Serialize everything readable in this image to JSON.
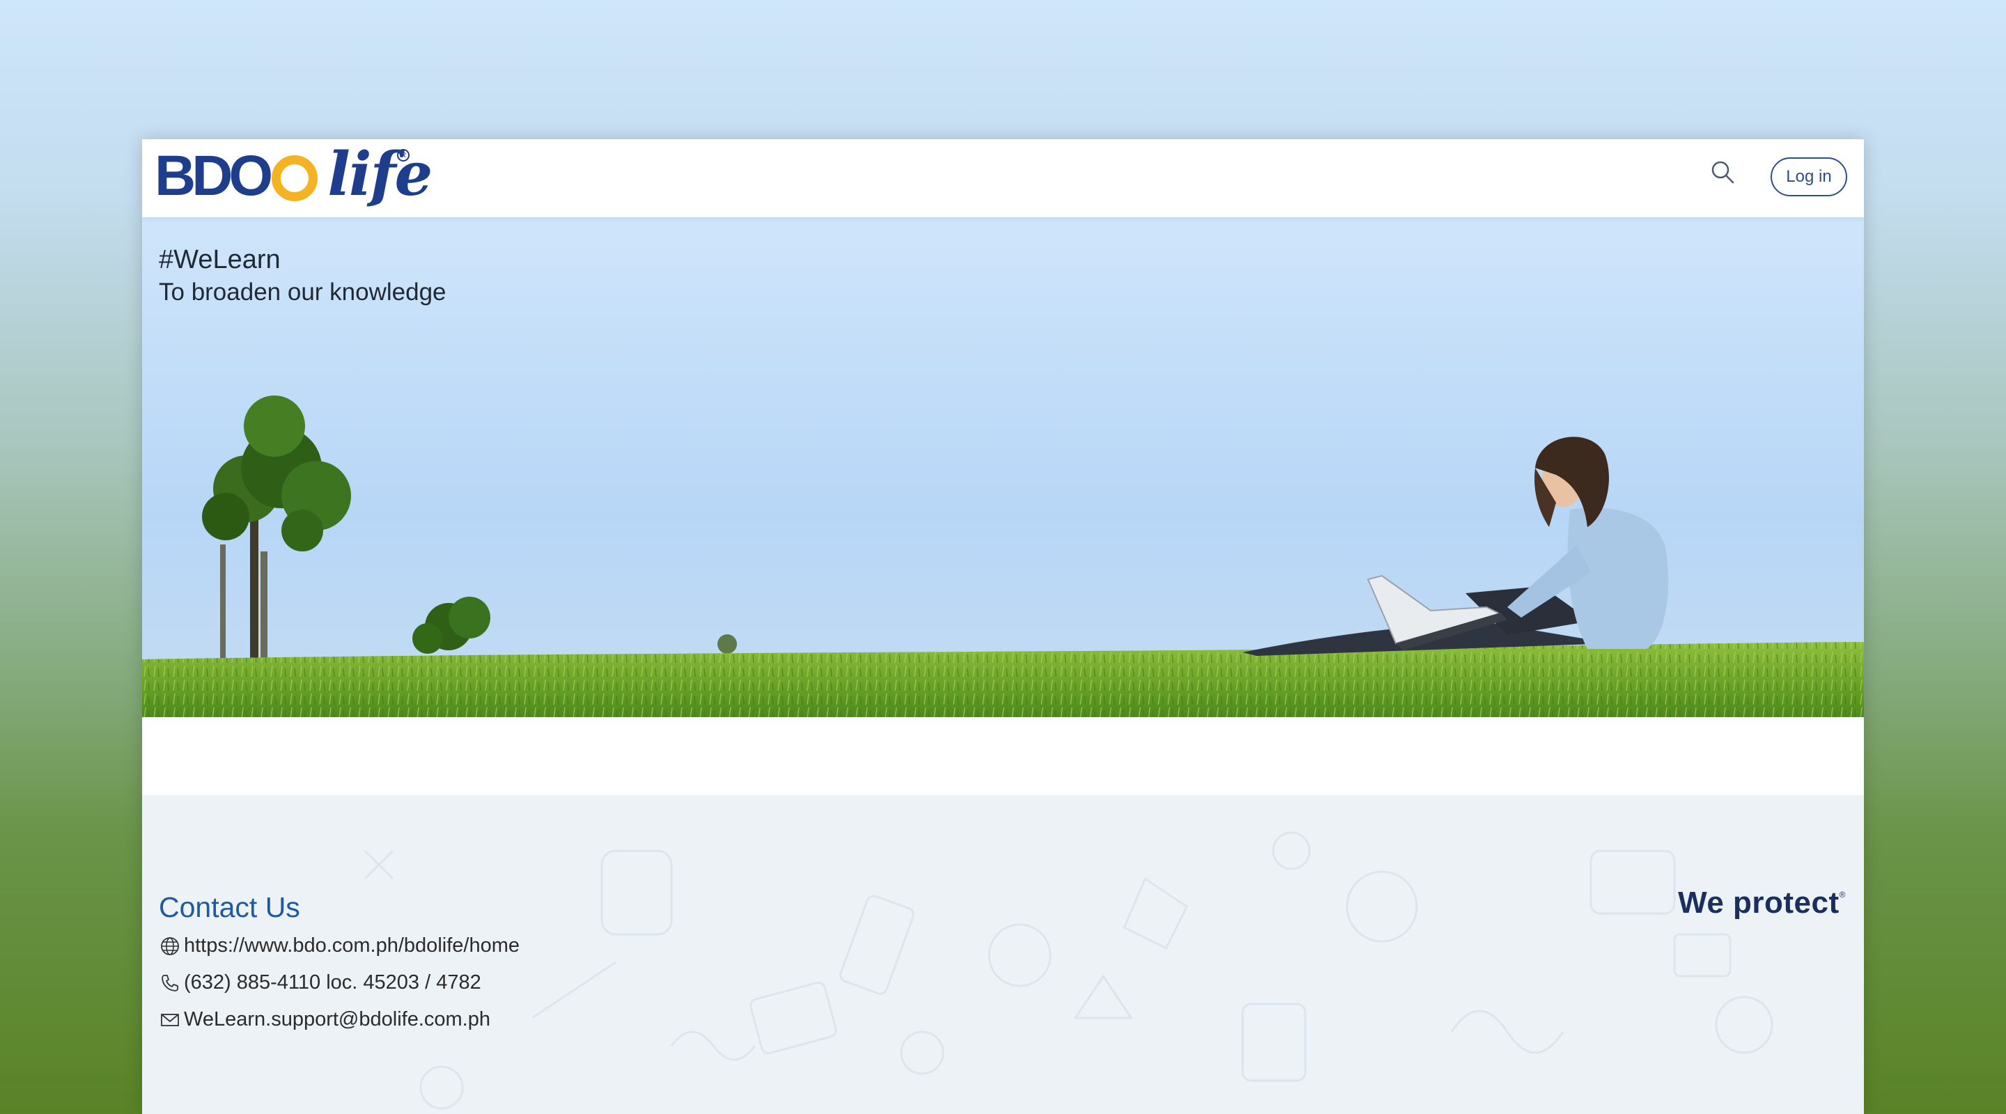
{
  "navbar": {
    "logo_brand": "BDO",
    "logo_product": "life",
    "search_icon": "search-icon",
    "login_label": "Log in"
  },
  "hero": {
    "title": "#WeLearn",
    "subtitle": "To broaden our knowledge"
  },
  "footer": {
    "contact_title": "Contact Us",
    "contacts": [
      {
        "icon": "globe-icon",
        "text": "https://www.bdo.com.ph/bdolife/home"
      },
      {
        "icon": "phone-icon",
        "text": "(632) 885-4110 loc. 45203 / 4782"
      },
      {
        "icon": "mail-icon",
        "text": "WeLearn.support@bdolife.com.ph"
      }
    ],
    "tagline": "We protect"
  },
  "colors": {
    "brand_blue": "#1e3d8c",
    "brand_gold": "#f4b323",
    "link_blue": "#1f5aa0"
  }
}
